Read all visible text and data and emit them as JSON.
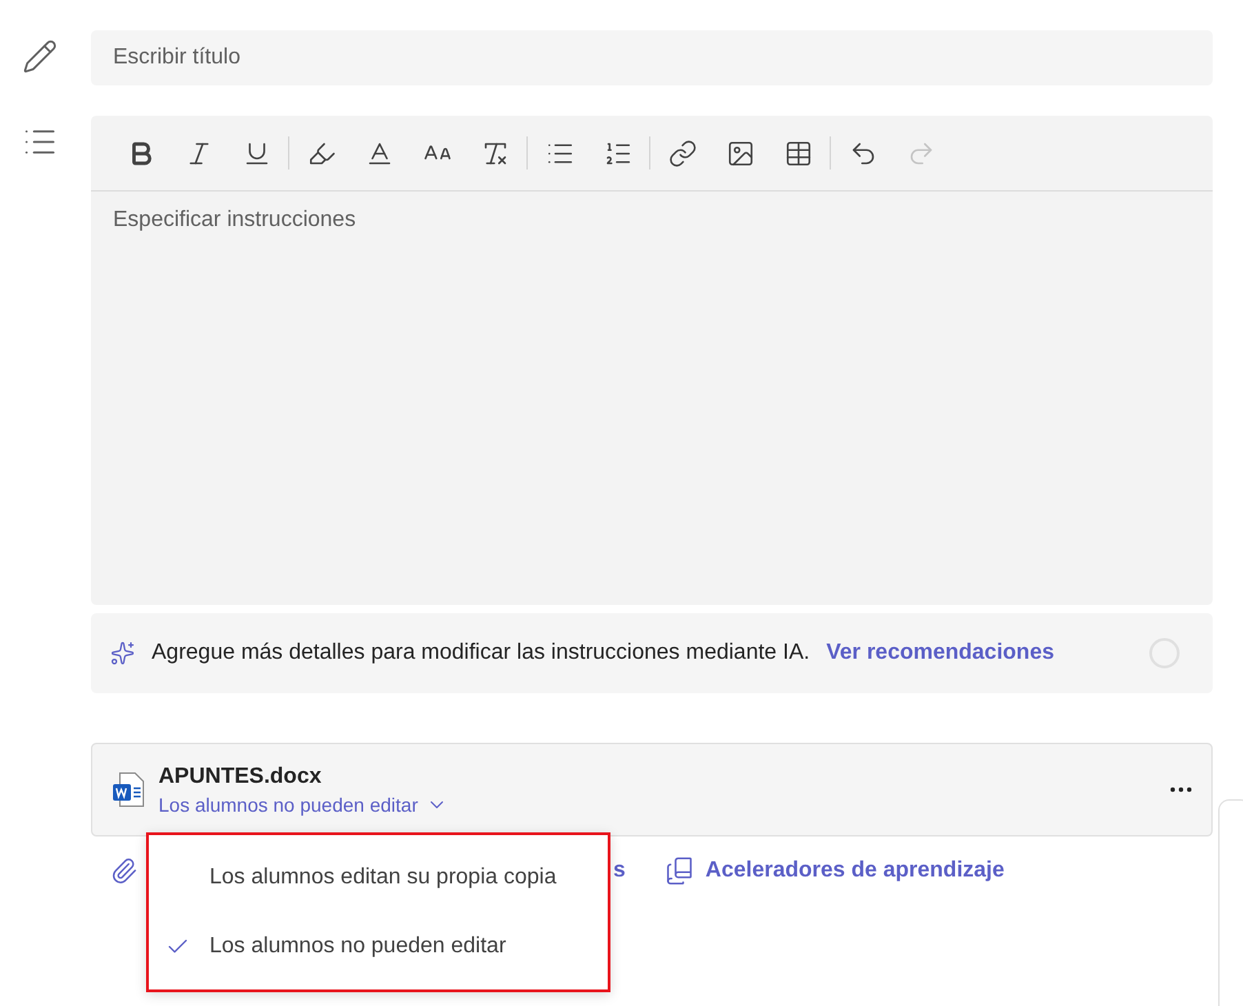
{
  "title_field": {
    "placeholder": "Escribir título"
  },
  "toolbar": [
    {
      "kind": "bold",
      "disabled": false
    },
    {
      "kind": "italic",
      "disabled": false
    },
    {
      "kind": "underline",
      "disabled": false
    },
    {
      "kind": "sep"
    },
    {
      "kind": "highlight",
      "disabled": false
    },
    {
      "kind": "font-color",
      "disabled": false
    },
    {
      "kind": "font-size",
      "disabled": false
    },
    {
      "kind": "clear-format",
      "disabled": false
    },
    {
      "kind": "sep"
    },
    {
      "kind": "bullets",
      "disabled": false
    },
    {
      "kind": "numbered",
      "disabled": false
    },
    {
      "kind": "sep"
    },
    {
      "kind": "link",
      "disabled": false
    },
    {
      "kind": "image",
      "disabled": false
    },
    {
      "kind": "table",
      "disabled": false
    },
    {
      "kind": "sep"
    },
    {
      "kind": "undo",
      "disabled": false
    },
    {
      "kind": "redo",
      "disabled": true
    }
  ],
  "instructions": {
    "placeholder": "Especificar instrucciones"
  },
  "ai_bar": {
    "text": "Agregue más detalles para modificar las instrucciones mediante IA.",
    "link": "Ver recomendaciones"
  },
  "file": {
    "name": "APUNTES.docx",
    "permission": "Los alumnos no pueden editar"
  },
  "links": {
    "attach_visible": "s",
    "accelerators": "Aceleradores de aprendizaje"
  },
  "menu": [
    {
      "label": "Los alumnos editan su propia copia",
      "selected": false
    },
    {
      "label": "Los alumnos no pueden editar",
      "selected": true
    }
  ]
}
